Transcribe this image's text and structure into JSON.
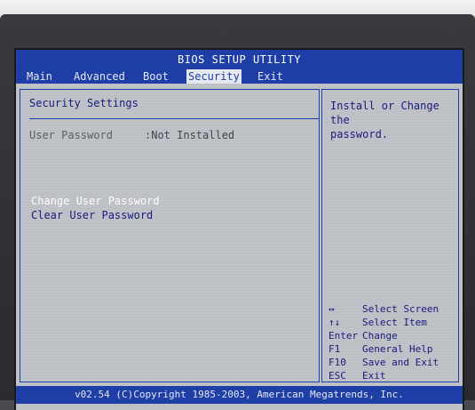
{
  "bios": {
    "title": "BIOS SETUP UTILITY",
    "menu": [
      {
        "label": "Main"
      },
      {
        "label": "Advanced"
      },
      {
        "label": "Boot"
      },
      {
        "label": "Security"
      },
      {
        "label": "Exit"
      }
    ],
    "active_menu": "Security",
    "section_title": "Security Settings",
    "user_password": {
      "label": "User Password",
      "value": ":Not Installed"
    },
    "actions": [
      {
        "label": "Change User Password"
      },
      {
        "label": "Clear User Password"
      }
    ],
    "selected_action": "Change User Password",
    "help_text": "Install or Change the\npassword.",
    "key_help": [
      {
        "key": "↔",
        "desc": "Select Screen"
      },
      {
        "key": "↑↓",
        "desc": "Select Item"
      },
      {
        "key": "Enter",
        "desc": "Change"
      },
      {
        "key": "F1",
        "desc": "General Help"
      },
      {
        "key": "F10",
        "desc": "Save and Exit"
      },
      {
        "key": "ESC",
        "desc": "Exit"
      }
    ],
    "footer": "v02.54 (C)Copyright 1985-2003, American Megatrends, Inc.",
    "colors": {
      "title_bar": "#1f3fa8",
      "panel_bg": "#bfc3c7",
      "text_dark_blue": "#1a1a80",
      "text_grey": "#5a5f6a",
      "highlight_text": "#ffffff"
    }
  }
}
